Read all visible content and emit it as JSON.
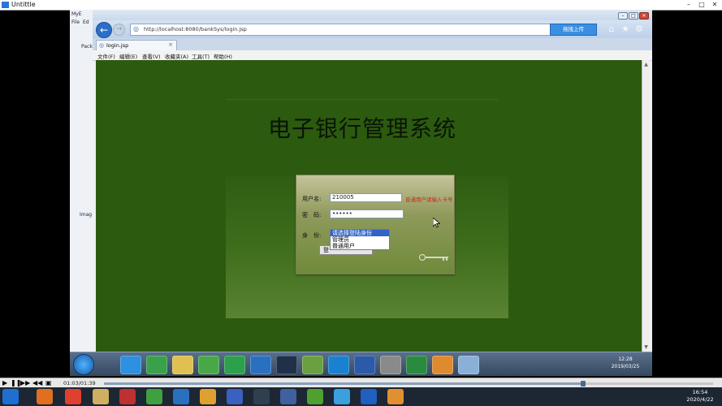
{
  "player": {
    "window_title": "Untittle",
    "time": "01:03/01:39",
    "progress": 0.787
  },
  "ide": {
    "title": "MyE",
    "menu_items": [
      "File",
      "Ed"
    ],
    "panel_labels": [
      "Pack",
      "Imag"
    ]
  },
  "browser": {
    "url": "http://localhost:8080/bankSys/login.jsp",
    "upload_label": "拖拽上传",
    "tab_title": "login.jsp",
    "menu": [
      "文件(F)",
      "编辑(E)",
      "查看(V)",
      "收藏夹(A)",
      "工具(T)",
      "帮助(H)"
    ]
  },
  "page": {
    "title": "电子银行管理系统",
    "username_label": "用户名:",
    "username_value": "210005",
    "username_hint": "普通用户请输入卡号",
    "password_label": "密　码:",
    "password_value": "••••••",
    "role_label": "身　份:",
    "role_options": [
      "请选择登陆身份",
      "管理员",
      "普通用户"
    ],
    "role_selected": 0,
    "login_label": "登"
  },
  "w7_taskbar": {
    "time": "12:28",
    "date": "2019/03/25"
  },
  "w10_taskbar": {
    "time": "16:54",
    "date": "2020/4/22"
  },
  "colors": {
    "page_bg": "#2c5a0f",
    "accent": "#3163c9",
    "hint": "#c8281e"
  }
}
